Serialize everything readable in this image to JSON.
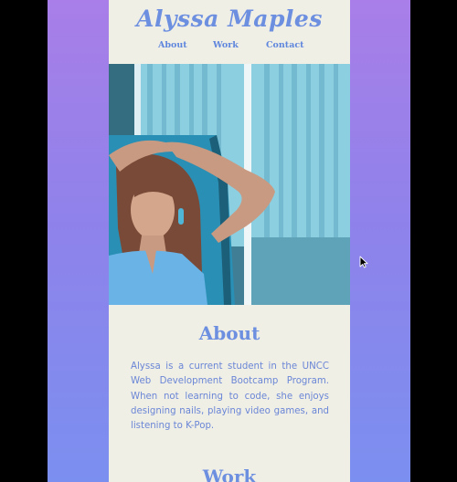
{
  "site": {
    "title": "Alyssa Maples"
  },
  "nav": {
    "items": [
      "About",
      "Work",
      "Contact"
    ]
  },
  "about": {
    "heading": "About",
    "body": "Alyssa is a current student in the UNCC Web Development Bootcamp Program. When not learning to code, she enjoys designing nails, playing video games, and listening to K-Pop."
  },
  "work": {
    "heading": "Work"
  },
  "colors": {
    "accent": "#6d8fe0",
    "card_background": "#f0efe6",
    "gradient_top": "#a97ee8",
    "gradient_bottom": "#7b8ff0"
  },
  "icons": {
    "cursor": "mouse-pointer-icon"
  }
}
